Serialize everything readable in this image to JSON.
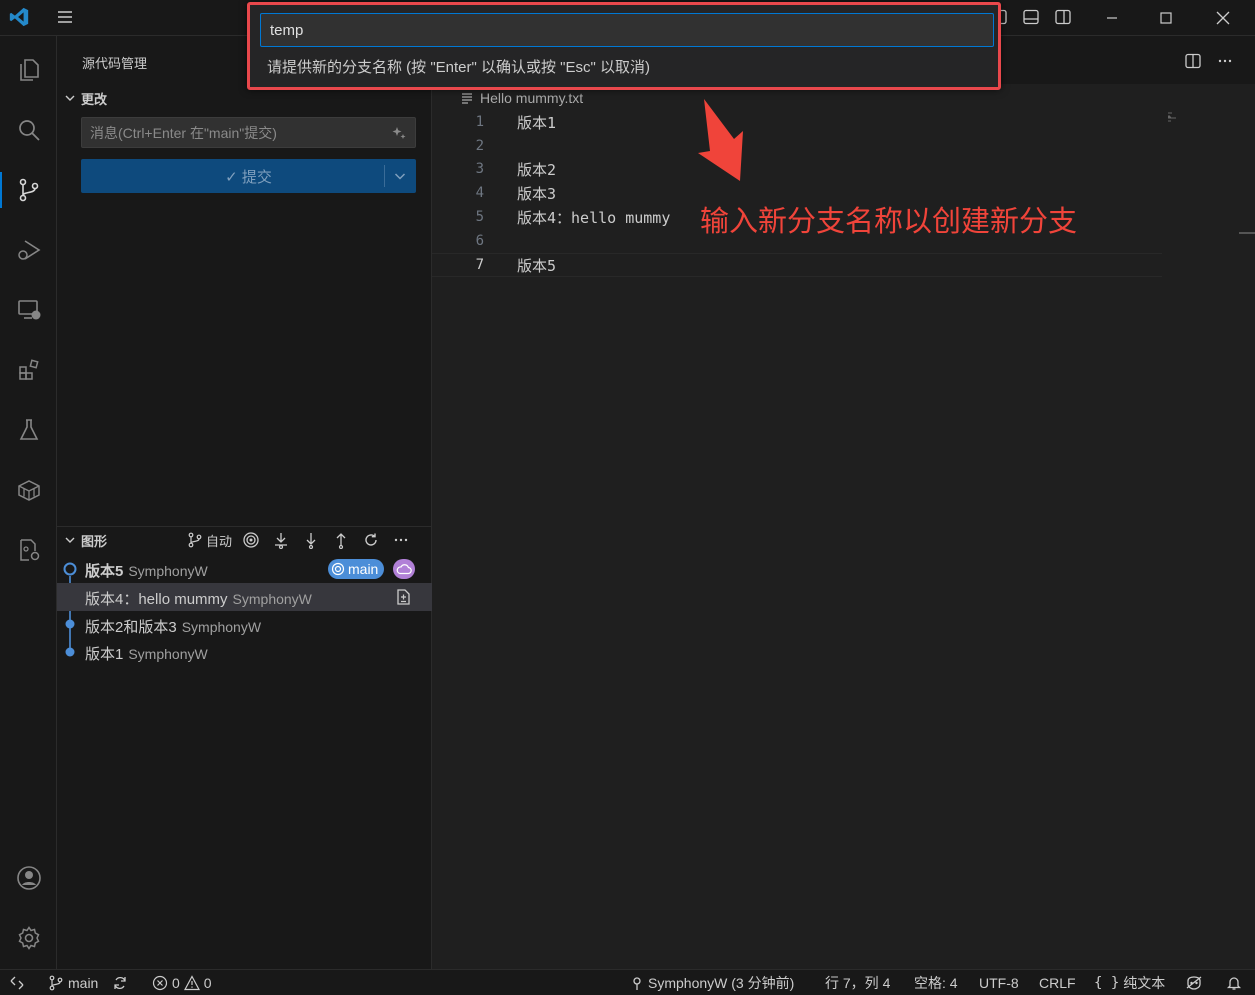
{
  "quick_input": {
    "value": "temp",
    "message": "请提供新的分支名称 (按 \"Enter\" 以确认或按 \"Esc\" 以取消)"
  },
  "sidebar": {
    "title": "源代码管理",
    "changes": {
      "header": "更改",
      "message_placeholder": "消息(Ctrl+Enter 在\"main\"提交)",
      "commit_label": "✓ 提交"
    },
    "graph": {
      "header": "图形",
      "auto_label": "自动",
      "commits": [
        {
          "title": "版本5",
          "author": "SymphonyW",
          "branch": "main"
        },
        {
          "title": "版本4：hello mummy",
          "author": "SymphonyW"
        },
        {
          "title": "版本2和版本3",
          "author": "SymphonyW"
        },
        {
          "title": "版本1",
          "author": "SymphonyW"
        }
      ]
    }
  },
  "editor": {
    "breadcrumb": "Hello mummy.txt",
    "lines": [
      {
        "num": "1",
        "text": "版本1"
      },
      {
        "num": "2",
        "text": ""
      },
      {
        "num": "3",
        "text": "版本2"
      },
      {
        "num": "4",
        "text": "版本3"
      },
      {
        "num": "5",
        "text": "版本4：hello mummy"
      },
      {
        "num": "6",
        "text": ""
      },
      {
        "num": "7",
        "text": "版本5"
      }
    ]
  },
  "annotation": {
    "text": "输入新分支名称以创建新分支",
    "color": "#f0443a"
  },
  "statusbar": {
    "branch": "main",
    "errors": "0",
    "warnings": "0",
    "blame": "SymphonyW (3 分钟前)",
    "position": "行 7，列 4",
    "spaces": "空格: 4",
    "encoding": "UTF-8",
    "eol": "CRLF",
    "language": "纯文本"
  },
  "colors": {
    "accent": "#0078d4",
    "branch_badge": "#4c8ed8",
    "remote_badge": "#b180d7",
    "highlight_border": "#e9484c"
  }
}
